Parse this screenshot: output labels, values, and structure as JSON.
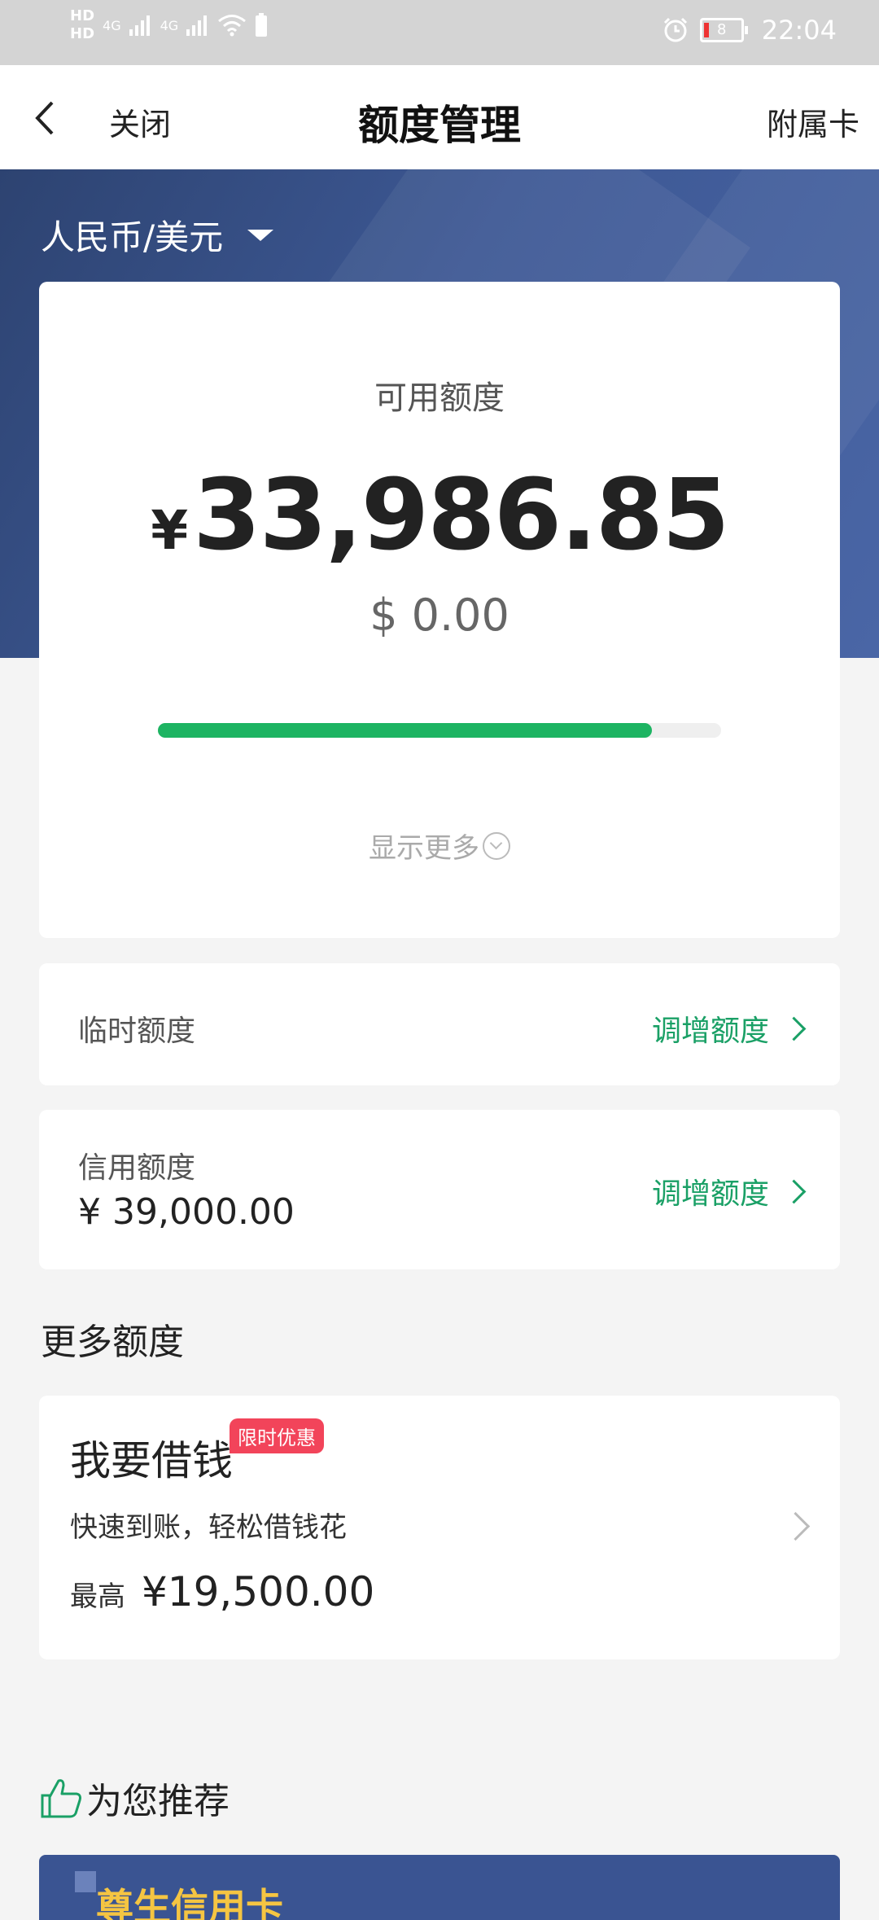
{
  "status_bar": {
    "network_badges": [
      "HD",
      "HD"
    ],
    "signal_labels": [
      "4G",
      "4G"
    ],
    "battery_level": "8",
    "time": "22:04"
  },
  "nav": {
    "close_label": "关闭",
    "title": "额度管理",
    "right_label": "附属卡"
  },
  "currency_selector": {
    "value": "人民币/美元"
  },
  "available": {
    "label": "可用额度",
    "currency_symbol": "¥",
    "value": "33,986.85",
    "usd_value": "$ 0.00",
    "usage_fraction": 0.877,
    "show_more_label": "显示更多"
  },
  "temporary_limit": {
    "label": "临时额度",
    "action_label": "调增额度"
  },
  "credit_limit": {
    "label": "信用额度",
    "value": "¥ 39,000.00",
    "action_label": "调增额度"
  },
  "more_limits": {
    "section_title": "更多额度",
    "loan": {
      "title": "我要借钱",
      "badge": "限时优惠",
      "subtitle": "快速到账，轻松借钱花",
      "max_label": "最高",
      "max_value": "¥19,500.00"
    }
  },
  "recommend": {
    "title": "为您推荐",
    "banner_text": "尊生信用卡"
  },
  "colors": {
    "accent_green": "#1aa066",
    "progress_green": "#1db462",
    "header_blue": "#3d5894",
    "badge_red": "#f2445a"
  }
}
